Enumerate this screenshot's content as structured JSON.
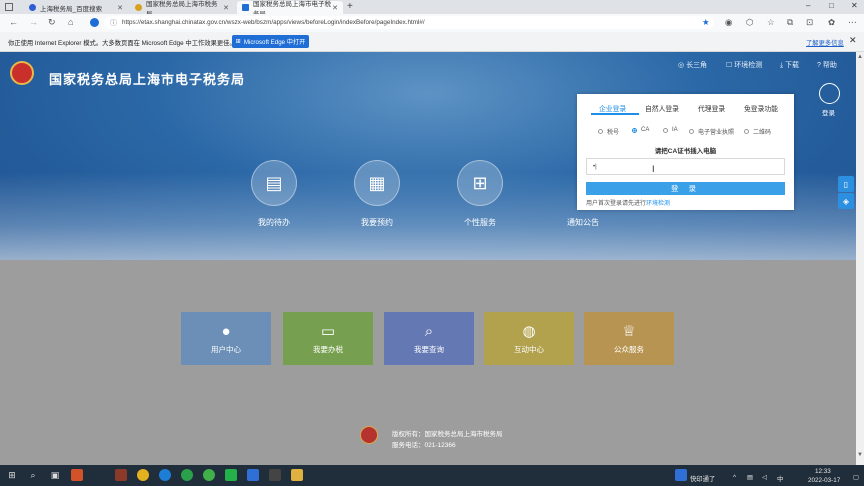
{
  "browser": {
    "tabs": [
      {
        "title": "上海税务局_百度搜索",
        "active": false
      },
      {
        "title": "国家税务总局上海市税务局",
        "active": false
      },
      {
        "title": "国家税务总局上海市电子税务局",
        "active": true
      }
    ],
    "url": "https://etax.shanghai.chinatax.gov.cn/wszx-web/bszm/apps/views/beforeLogin/indexBefore/pageIndex.html#/",
    "infobar": {
      "text": "你正使用 Internet Explorer 模式。大多数页面在 Microsoft Edge 中工作效果更佳。",
      "button": "Microsoft Edge 中打开",
      "link": "了解更多信息"
    }
  },
  "site": {
    "title": "国家税务总局上海市电子税务局",
    "top_links": [
      "长三角",
      "环境检测",
      "下载",
      "帮助"
    ],
    "login_label": "登录",
    "quick_entries": [
      {
        "label": "我的待办",
        "icon": "clipboard-icon"
      },
      {
        "label": "我要预约",
        "icon": "calendar-icon"
      },
      {
        "label": "个性服务",
        "icon": "grid-icon"
      },
      {
        "label": "通知公告",
        "icon": "notice-icon"
      }
    ],
    "cards": [
      {
        "label": "用户中心",
        "color": "#6b8fb6",
        "icon": "user-icon"
      },
      {
        "label": "我要办税",
        "color": "#76a04f",
        "icon": "monitor-icon"
      },
      {
        "label": "我要查询",
        "color": "#6478b3",
        "icon": "search-doc-icon"
      },
      {
        "label": "互动中心",
        "color": "#b2a24e",
        "icon": "chat-icon"
      },
      {
        "label": "公众服务",
        "color": "#b89452",
        "icon": "badge-icon"
      }
    ],
    "footer": {
      "copyright": "版权所有：国家税务总局上海市税务局",
      "phone": "服务电话：021-12366"
    }
  },
  "login_dialog": {
    "tabs": [
      "企业登录",
      "自然人登录",
      "代理登录",
      "免登录功能"
    ],
    "active_tab": 0,
    "methods": [
      "税号",
      "CA",
      "IA",
      "电子营业执照",
      "二维码"
    ],
    "selected_method": "CA",
    "prompt": "请把CA证书插入电脑",
    "input_value": "•|",
    "button": "登 录",
    "tip_prefix": "用户首次登录请先进行",
    "tip_link": "环境检测"
  },
  "system": {
    "ime": "快印通了",
    "time": "12:33",
    "date": "2022-03-17"
  }
}
